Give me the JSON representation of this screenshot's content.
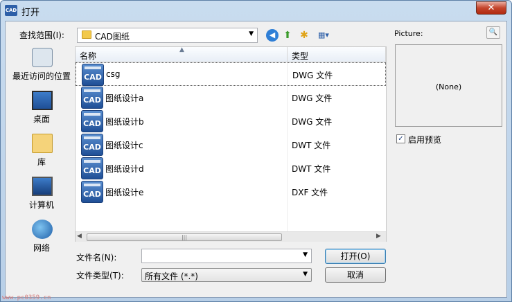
{
  "window": {
    "title": "打开",
    "icon_label": "CAD",
    "close_glyph": "✕"
  },
  "toolbar": {
    "look_in_label": "查找范围(I):",
    "look_in_value": "CAD图纸",
    "combo_arrow": "▼",
    "views_glyph": "▦▾"
  },
  "places": [
    {
      "label": "最近访问的位置",
      "icon": "recent-places-icon"
    },
    {
      "label": "桌面",
      "icon": "desktop-icon"
    },
    {
      "label": "库",
      "icon": "library-icon"
    },
    {
      "label": "计算机",
      "icon": "computer-icon"
    },
    {
      "label": "网络",
      "icon": "network-icon"
    }
  ],
  "filelist": {
    "columns": {
      "name": "名称",
      "type": "类型"
    },
    "files": [
      {
        "name": "csg",
        "type": "DWG 文件",
        "icon_label": "CAD"
      },
      {
        "name": "图纸设计a",
        "type": "DWG 文件",
        "icon_label": "CAD"
      },
      {
        "name": "图纸设计b",
        "type": "DWG 文件",
        "icon_label": "CAD"
      },
      {
        "name": "图纸设计c",
        "type": "DWT 文件",
        "icon_label": "CAD"
      },
      {
        "name": "图纸设计d",
        "type": "DWT 文件",
        "icon_label": "CAD"
      },
      {
        "name": "图纸设计e",
        "type": "DXF 文件",
        "icon_label": "CAD"
      }
    ]
  },
  "form": {
    "filename_label": "文件名(N):",
    "filename_value": "",
    "filetype_label": "文件类型(T):",
    "filetype_value": "所有文件 (*.*)",
    "open_button": "打开(O)",
    "cancel_button": "取消"
  },
  "preview": {
    "label": "Picture:",
    "placeholder": "(None)",
    "checkbox_label": "启用预览",
    "checkbox_checked": true
  },
  "watermark": "www.pc0359.cn"
}
